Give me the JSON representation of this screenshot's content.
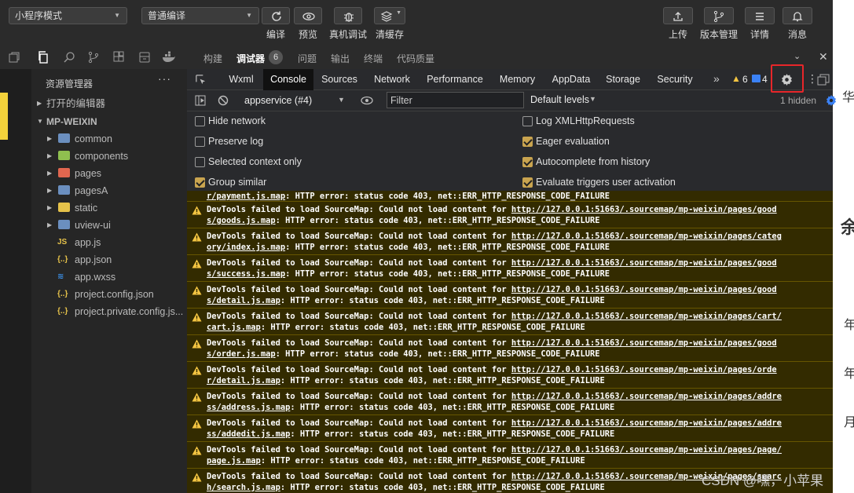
{
  "toolbar": {
    "mode_select": "小程序模式",
    "compile_select": "普通编译",
    "buttons": [
      {
        "label": "编译",
        "icon": "refresh-icon"
      },
      {
        "label": "预览",
        "icon": "eye-icon"
      },
      {
        "label": "真机调试",
        "icon": "bug-icon"
      },
      {
        "label": "清缓存",
        "icon": "layers-icon"
      }
    ],
    "right_buttons": [
      {
        "label": "上传",
        "icon": "upload-icon"
      },
      {
        "label": "版本管理",
        "icon": "branch-icon"
      },
      {
        "label": "详情",
        "icon": "menu-icon"
      },
      {
        "label": "消息",
        "icon": "bell-icon"
      }
    ]
  },
  "explorer": {
    "title": "资源管理器",
    "more": "···",
    "open_editors": "打开的编辑器",
    "project": "MP-WEIXIN",
    "items": [
      {
        "label": "common",
        "type": "folder",
        "color": "#6b8fbf"
      },
      {
        "label": "components",
        "type": "folder",
        "color": "#8fbf4f"
      },
      {
        "label": "pages",
        "type": "folder",
        "color": "#e0664f"
      },
      {
        "label": "pagesA",
        "type": "folder",
        "color": "#6b8fbf"
      },
      {
        "label": "static",
        "type": "folder",
        "color": "#e6c24a"
      },
      {
        "label": "uview-ui",
        "type": "folder",
        "color": "#6b8fbf"
      },
      {
        "label": "app.js",
        "type": "js",
        "color": "#e6c24a"
      },
      {
        "label": "app.json",
        "type": "json",
        "color": "#e6c24a"
      },
      {
        "label": "app.wxss",
        "type": "wxss",
        "color": "#3b8fe6"
      },
      {
        "label": "project.config.json",
        "type": "json",
        "color": "#e6c24a"
      },
      {
        "label": "project.private.config.js...",
        "type": "json",
        "color": "#e6c24a"
      }
    ]
  },
  "devtools": {
    "top_tabs": [
      "构建",
      "调试器",
      "问题",
      "输出",
      "终端",
      "代码质量"
    ],
    "active_top_tab": "调试器",
    "debugger_badge": "6",
    "panel_tabs": [
      "Wxml",
      "Console",
      "Sources",
      "Network",
      "Performance",
      "Memory",
      "AppData",
      "Storage",
      "Security"
    ],
    "active_panel_tab": "Console",
    "more_tabs": "»",
    "warning_count": "6",
    "info_count": "4",
    "context_select": "appservice (#4)",
    "filter_placeholder": "Filter",
    "levels_select": "Default levels",
    "hidden_count": "1 hidden"
  },
  "settings": {
    "left": [
      {
        "label": "Hide network",
        "checked": false
      },
      {
        "label": "Preserve log",
        "checked": false
      },
      {
        "label": "Selected context only",
        "checked": false
      },
      {
        "label": "Group similar",
        "checked": true
      }
    ],
    "right": [
      {
        "label": "Log XMLHttpRequests",
        "checked": false
      },
      {
        "label": "Eager evaluation",
        "checked": true
      },
      {
        "label": "Autocomplete from history",
        "checked": true
      },
      {
        "label": "Evaluate triggers user activation",
        "checked": true
      }
    ]
  },
  "logs": {
    "prefix": "DevTools failed to load SourceMap: Could not load content for ",
    "error_suffix": ": HTTP error: status code 403, net::ERR_HTTP_RESPONSE_CODE_FAILURE",
    "partial_first": "r/payment.js.map",
    "partial_first_rest": ": HTTP error: status code 403, net::ERR_HTTP_RESPONSE_CODE_FAILURE",
    "entries": [
      {
        "url1": "http://127.0.0.1:51663/.sourcemap/mp-weixin/pages/good",
        "url2": "s/goods.js.map"
      },
      {
        "url1": "http://127.0.0.1:51663/.sourcemap/mp-weixin/pages/categ",
        "url2": "ory/index.js.map"
      },
      {
        "url1": "http://127.0.0.1:51663/.sourcemap/mp-weixin/pages/good",
        "url2": "s/success.js.map"
      },
      {
        "url1": "http://127.0.0.1:51663/.sourcemap/mp-weixin/pages/good",
        "url2": "s/detail.js.map"
      },
      {
        "url1": "http://127.0.0.1:51663/.sourcemap/mp-weixin/pages/cart/",
        "url2": "cart.js.map"
      },
      {
        "url1": "http://127.0.0.1:51663/.sourcemap/mp-weixin/pages/good",
        "url2": "s/order.js.map"
      },
      {
        "url1": "http://127.0.0.1:51663/.sourcemap/mp-weixin/pages/orde",
        "url2": "r/detail.js.map"
      },
      {
        "url1": "http://127.0.0.1:51663/.sourcemap/mp-weixin/pages/addre",
        "url2": "ss/address.js.map"
      },
      {
        "url1": "http://127.0.0.1:51663/.sourcemap/mp-weixin/pages/addre",
        "url2": "ss/addedit.js.map"
      },
      {
        "url1": "http://127.0.0.1:51663/.sourcemap/mp-weixin/pages/page/",
        "url2": "page.js.map"
      },
      {
        "url1": "http://127.0.0.1:51663/.sourcemap/mp-weixin/pages/searc",
        "url2": "h/search.js.map"
      }
    ]
  },
  "watermark": "CSDN @嘿，小苹果",
  "background_fragments": [
    "华",
    "余",
    "年",
    "年",
    "月"
  ],
  "colors": {
    "warn_bg": "#332b00",
    "warn_icon": "#f4c542",
    "highlight_box": "#e8262a",
    "checkbox_on": "#c9a44f"
  }
}
